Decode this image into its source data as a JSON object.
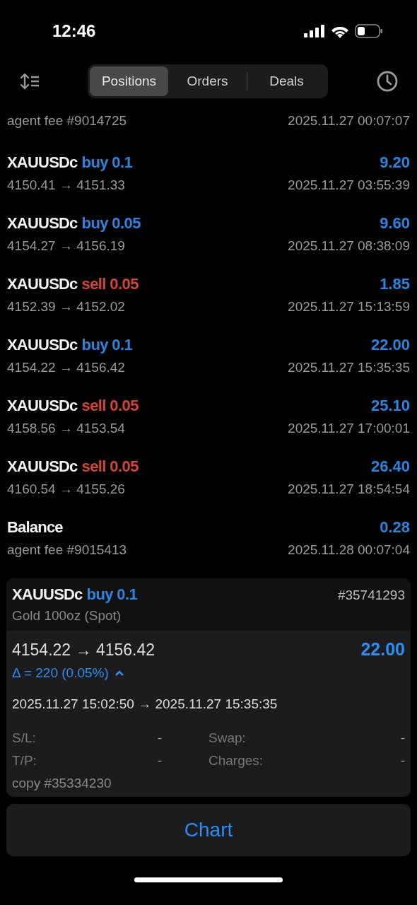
{
  "status_bar": {
    "time": "12:46"
  },
  "tabs": [
    {
      "label": "Positions",
      "selected": true
    },
    {
      "label": "Orders",
      "selected": false
    },
    {
      "label": "Deals",
      "selected": false
    }
  ],
  "deals": [
    {
      "kind": "balance",
      "comment": "agent fee #9014725",
      "time": "2025.11.27 00:07:07"
    },
    {
      "kind": "trade",
      "symbol": "XAUUSDc",
      "side": "buy",
      "volume": "0.1",
      "prices": "4150.41 → 4151.33",
      "profit": "9.20",
      "time": "2025.11.27 03:55:39"
    },
    {
      "kind": "trade",
      "symbol": "XAUUSDc",
      "side": "buy",
      "volume": "0.05",
      "prices": "4154.27 → 4156.19",
      "profit": "9.60",
      "time": "2025.11.27 08:38:09"
    },
    {
      "kind": "trade",
      "symbol": "XAUUSDc",
      "side": "sell",
      "volume": "0.05",
      "prices": "4152.39 → 4152.02",
      "profit": "1.85",
      "time": "2025.11.27 15:13:59"
    },
    {
      "kind": "trade",
      "symbol": "XAUUSDc",
      "side": "buy",
      "volume": "0.1",
      "prices": "4154.22 → 4156.42",
      "profit": "22.00",
      "time": "2025.11.27 15:35:35"
    },
    {
      "kind": "trade",
      "symbol": "XAUUSDc",
      "side": "sell",
      "volume": "0.05",
      "prices": "4158.56 → 4153.54",
      "profit": "25.10",
      "time": "2025.11.27 17:00:01"
    },
    {
      "kind": "trade",
      "symbol": "XAUUSDc",
      "side": "sell",
      "volume": "0.05",
      "prices": "4160.54 → 4155.26",
      "profit": "26.40",
      "time": "2025.11.27 18:54:54"
    },
    {
      "kind": "balance",
      "title": "Balance",
      "comment": "agent fee #9015413",
      "profit": "0.28",
      "time": "2025.11.28 00:07:04"
    }
  ],
  "detail": {
    "symbol": "XAUUSDc",
    "side": "buy",
    "volume": "0.1",
    "ticket": "#35741293",
    "description": "Gold 100oz (Spot)",
    "prices": "4154.22 → 4156.42",
    "profit": "22.00",
    "delta": "Δ = 220 (0.05%)",
    "times": "2025.11.27 15:02:50 → 2025.11.27 15:35:35",
    "fields": [
      {
        "label": "S/L:",
        "value": "-"
      },
      {
        "label": "Swap:",
        "value": "-"
      },
      {
        "label": "T/P:",
        "value": "-"
      },
      {
        "label": "Charges:",
        "value": "-"
      }
    ],
    "comment": "copy #35334230"
  },
  "chart_button": "Chart"
}
